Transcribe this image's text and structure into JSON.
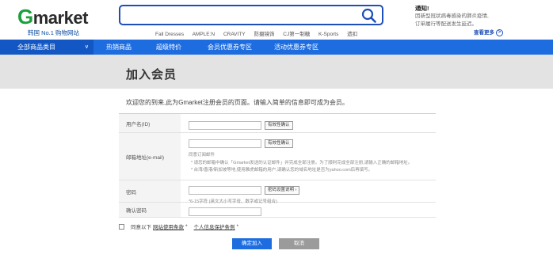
{
  "header": {
    "logo_word": "market",
    "logo_g": "G",
    "logo_sub": "韩国 No.1 购物网站",
    "search": {
      "value": "",
      "placeholder": ""
    },
    "keywords": [
      "Fall Dresses",
      "AMPLE:N",
      "CRAVITY",
      "防摄镜饰",
      "CJ第一制糖",
      "K-Sports",
      "遗扣"
    ],
    "notice": {
      "title": "通知!",
      "text_1": "因新型冠状病毒感染的肺炎疫情,",
      "text_2": "订单履行等配送发生延迟。",
      "more": "查看更多",
      "more_icon": ">"
    }
  },
  "nav": {
    "category": "全部商品类目",
    "category_chevron": "∨",
    "items": [
      "热销商品",
      "超级特价",
      "会员优惠券专区",
      "活动优惠券专区"
    ]
  },
  "page": {
    "title": "加入会员",
    "intro": "欢迎您的到来,此为Gmarket注册会员的页面。请输入简单的信息即可成为会员。"
  },
  "form": {
    "userid": {
      "label": "用户名(ID)",
      "value": "",
      "check_button": "有效性确认"
    },
    "email": {
      "label": "邮箱地址(e-mail)",
      "value": "",
      "check_button": "有效性确认",
      "subscribe": "同意订阅邮件",
      "hint_1": "* 请您的邮箱中确认「Gmarket发送的认证邮件」并完成全部注册。为了顺利完成全部注册,请输入正确的邮箱地址。",
      "hint_2": "* 台湾/香港/新加坡等地,使用雅虎邮箱的用户,请确认您的域名地址是否为yahoo.com后再填写。"
    },
    "password": {
      "label": "密码",
      "value": "",
      "help_button": "密码设置说明 ›",
      "hint": "*6-15字符 (英文大小写字母、数字或记号组合)"
    },
    "confirm_password": {
      "label": "确认密码",
      "value": ""
    }
  },
  "agreement": {
    "prefix": "同意以下",
    "terms_link": "网站使用条款",
    "star_1": "*",
    "privacy_link": "个人信息保护条例",
    "star_2": "*"
  },
  "buttons": {
    "join": "确定加入",
    "cancel": "取消"
  },
  "colors": {
    "brand_blue": "#1e6de0",
    "brand_green": "#1aa13b"
  },
  "icons": {
    "search": "search-icon",
    "chevron": "chevron-down-icon"
  }
}
